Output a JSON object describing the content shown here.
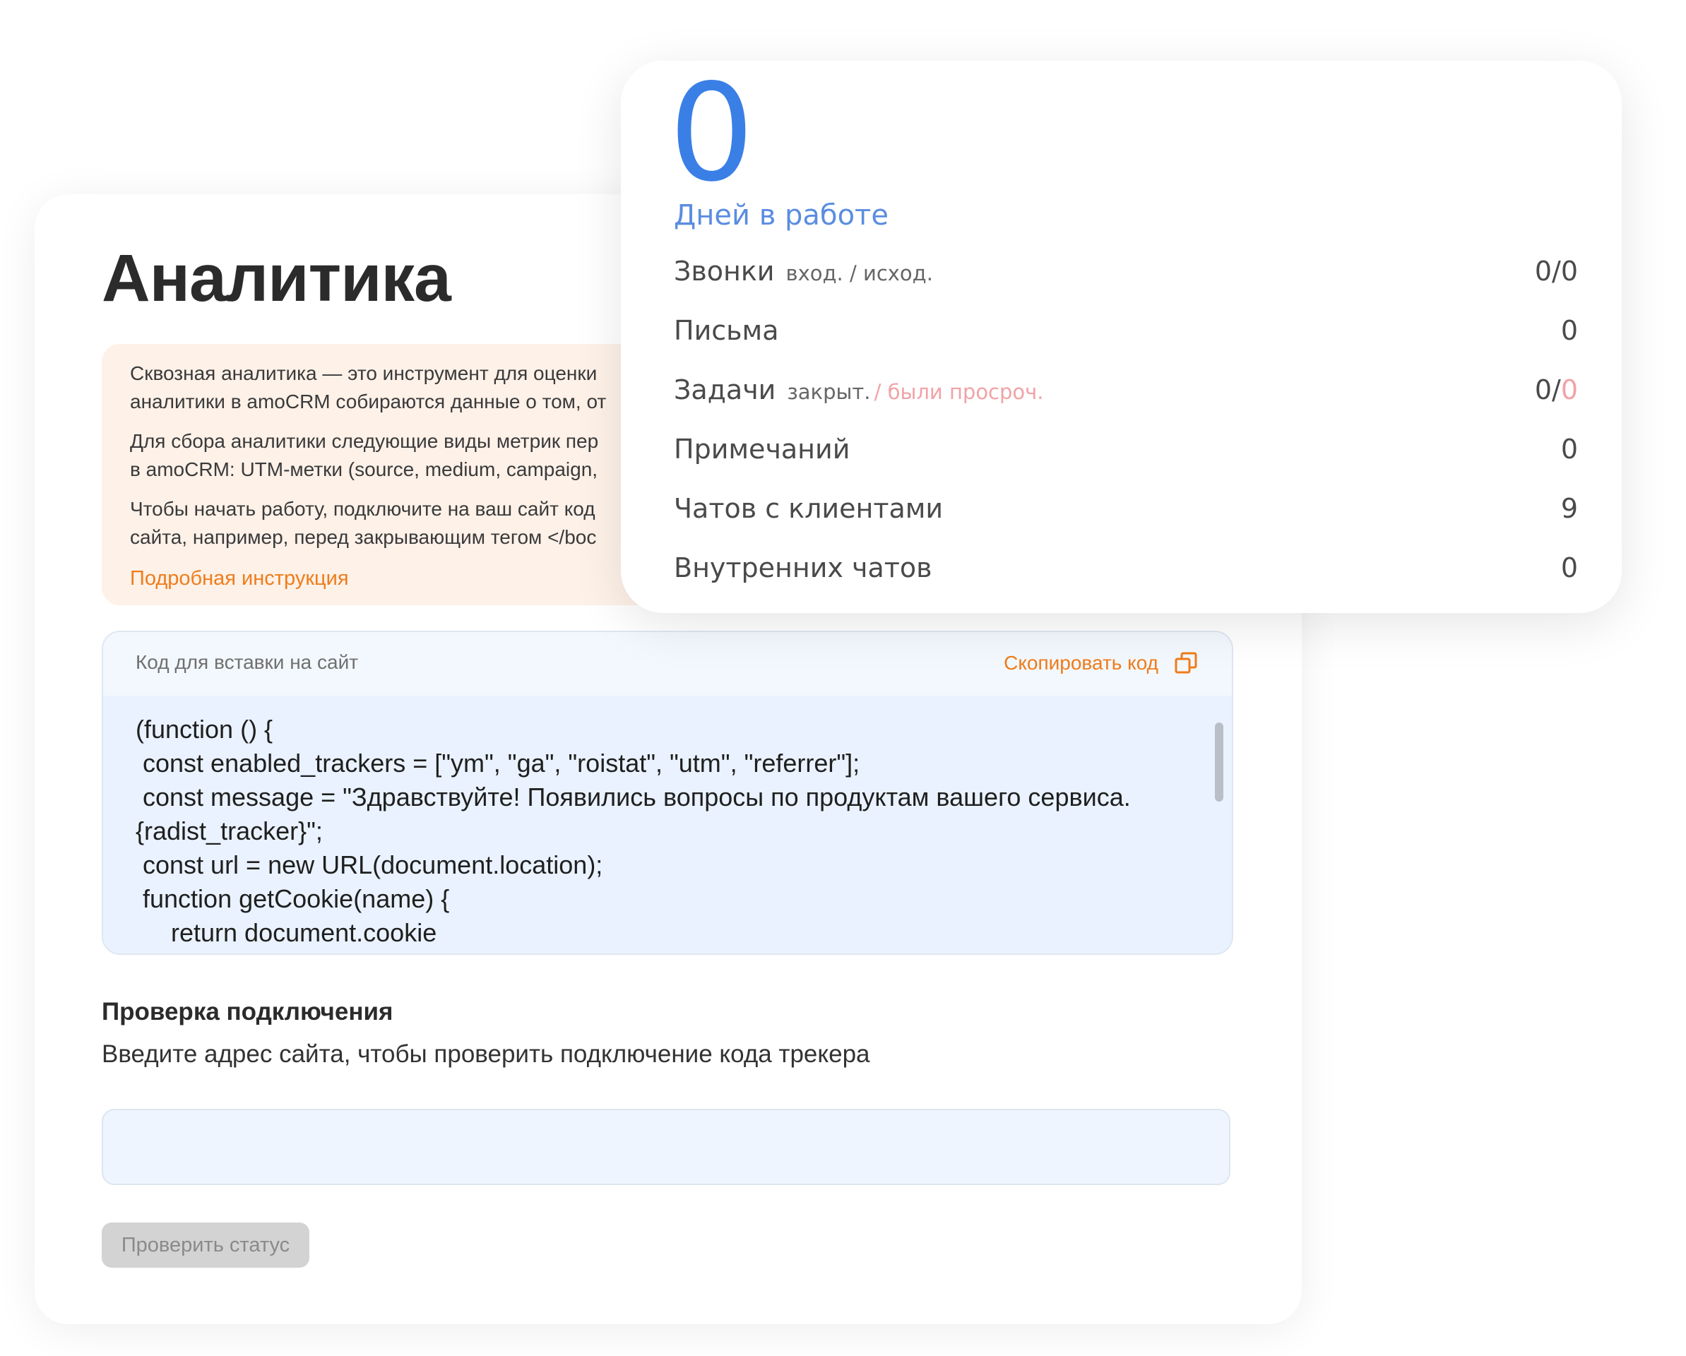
{
  "analytics": {
    "title": "Аналитика",
    "info": {
      "p1_line1": "Сквозная аналитика — это инструмент для оценки",
      "p1_line2": "аналитики в amoCRM собираются данные о том, от",
      "p2_line1": "Для сбора аналитики следующие виды метрик пер",
      "p2_line2": "в amoCRM: UTM-метки (source, medium, campaign,",
      "p3_line1": "Чтобы начать работу, подключите на ваш сайт код",
      "p3_line2": "сайта, например, перед закрывающим тегом </boc",
      "link": "Подробная инструкция"
    },
    "code": {
      "header_label": "Код для вставки на сайт",
      "copy_label": "Скопировать код",
      "copy_icon": "copy-icon",
      "lines": [
        "(function () {",
        " const enabled_trackers = [\"ym\", \"ga\", \"roistat\", \"utm\", \"referrer\"];",
        " const message = \"Здравствуйте! Появились вопросы по продуктам вашего сервиса.",
        "{radist_tracker}\";",
        " const url = new URL(document.location);",
        " function getCookie(name) {",
        "     return document.cookie"
      ]
    },
    "check": {
      "title": "Проверка подключения",
      "description": "Введите адрес сайта, чтобы проверить подключение кода трекера",
      "input_value": "",
      "button_label": "Проверить статус"
    }
  },
  "stats": {
    "days_value": "0",
    "days_label": "Дней в работе",
    "rows": [
      {
        "label": "Звонки",
        "sub": "вход. / исход.",
        "value": "0/0"
      },
      {
        "label": "Письма",
        "sub": "",
        "value": "0"
      },
      {
        "label": "Задачи",
        "sub": "закрыт.",
        "sub_red": "/ были просроч.",
        "value": "0/",
        "value_red": "0"
      },
      {
        "label": "Примечаний",
        "sub": "",
        "value": "0"
      },
      {
        "label": "Чатов с клиентами",
        "sub": "",
        "value": "9"
      },
      {
        "label": "Внутренних чатов",
        "sub": "",
        "value": "0"
      }
    ]
  },
  "colors": {
    "accent_orange": "#f07c1a",
    "accent_blue": "#3a7fe6",
    "overdue_red": "#f2a2a6"
  }
}
